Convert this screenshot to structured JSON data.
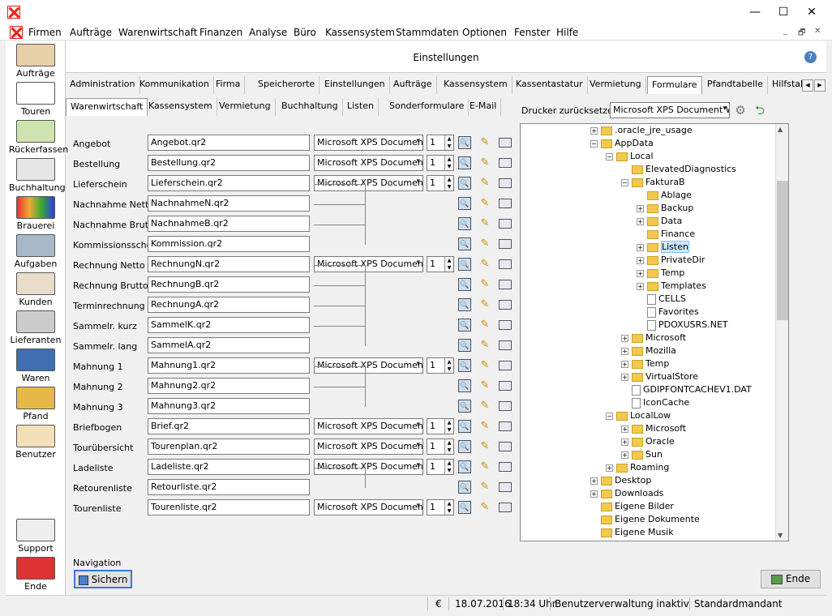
{
  "titlebar": {
    "close_glyph": "✕",
    "minimize": "—",
    "maximize": "☐",
    "close": "✕"
  },
  "menu": {
    "items": [
      "Firmen",
      "Aufträge",
      "Warenwirtschaft",
      "Finanzen",
      "Analyse",
      "Büro",
      "Kassensystem",
      "Stammdaten",
      "Optionen",
      "Fenster",
      "Hilfe"
    ],
    "mdi_min": "_",
    "mdi_restore": "🗗",
    "mdi_close": "✕"
  },
  "sidebar": {
    "items": [
      "Aufträge",
      "Touren",
      "Rückerfassen",
      "Buchhaltung",
      "Brauerei",
      "Aufgaben",
      "Kunden",
      "Lieferanten",
      "Waren",
      "Pfand",
      "Benutzer"
    ],
    "support": "Support",
    "ende": "Ende"
  },
  "header": {
    "title": "Einstellungen",
    "help_icon": "?"
  },
  "tabs_main": [
    "Administration",
    "Kommunikation",
    "Firma",
    "Speicherorte",
    "Einstellungen",
    "Aufträge",
    "Kassensystem",
    "Kassentastatur",
    "Vermietung",
    "Formulare",
    "Pfandtabelle",
    "Hilfstab"
  ],
  "tabs_sub": [
    "Warenwirtschaft",
    "Kassensystem",
    "Vermietung",
    "Buchhaltung",
    "Listen",
    "Sonderformulare",
    "E-Mail"
  ],
  "printer_reset": {
    "label": "Drucker zurücksetzen:",
    "value": "Microsoft XPS Document W"
  },
  "forms": [
    {
      "label": "Angebot",
      "file": "Angebot.qr2",
      "printer": "Microsoft XPS Documen",
      "copies": "1"
    },
    {
      "label": "Bestellung",
      "file": "Bestellung.qr2",
      "printer": "Microsoft XPS Documen",
      "copies": "1"
    },
    {
      "label": "Lieferschein",
      "file": "Lieferschein.qr2",
      "printer": "Microsoft XPS Documen",
      "copies": "1"
    },
    {
      "label": "Nachnahme Netto",
      "file": "NachnahmeN.qr2"
    },
    {
      "label": "Nachnahme Brutto",
      "file": "NachnahmeB.qr2"
    },
    {
      "label": "Kommissionsschein",
      "file": "Kommission.qr2"
    },
    {
      "label": "Rechnung Netto",
      "file": "RechnungN.qr2",
      "printer": "Microsoft XPS Documen",
      "copies": "1"
    },
    {
      "label": "Rechnung Brutto",
      "file": "RechnungB.qr2"
    },
    {
      "label": "Terminrechnung",
      "file": "RechnungA.qr2"
    },
    {
      "label": "Sammelr. kurz",
      "file": "SammelK.qr2"
    },
    {
      "label": "Sammelr. lang",
      "file": "SammelA.qr2"
    },
    {
      "label": "Mahnung 1",
      "file": "Mahnung1.qr2",
      "printer": "Microsoft XPS Documen",
      "copies": "1"
    },
    {
      "label": "Mahnung 2",
      "file": "Mahnung2.qr2"
    },
    {
      "label": "Mahnung 3",
      "file": "Mahnung3.qr2"
    },
    {
      "label": "Briefbogen",
      "file": "Brief.qr2",
      "printer": "Microsoft XPS Documen",
      "copies": "1"
    },
    {
      "label": "Tourübersicht",
      "file": "Tourenplan.qr2",
      "printer": "Microsoft XPS Documen",
      "copies": "1"
    },
    {
      "label": "Ladeliste",
      "file": "Ladeliste.qr2",
      "printer": "Microsoft XPS Documen",
      "copies": "1"
    },
    {
      "label": "Retourenliste",
      "file": "Retourliste.qr2"
    },
    {
      "label": "Tourenliste",
      "file": "Tourenliste.qr2",
      "printer": "Microsoft XPS Documen",
      "copies": "1"
    }
  ],
  "tree": [
    {
      "text": ".oracle_jre_usage",
      "depth": 1,
      "exp": "+",
      "type": "folder"
    },
    {
      "text": "AppData",
      "depth": 1,
      "exp": "-",
      "type": "folder"
    },
    {
      "text": "Local",
      "depth": 2,
      "exp": "-",
      "type": "folder"
    },
    {
      "text": "ElevatedDiagnostics",
      "depth": 3,
      "exp": "",
      "type": "folder"
    },
    {
      "text": "FakturaB",
      "depth": 3,
      "exp": "-",
      "type": "folder"
    },
    {
      "text": "Ablage",
      "depth": 4,
      "exp": "",
      "type": "folder"
    },
    {
      "text": "Backup",
      "depth": 4,
      "exp": "+",
      "type": "folder"
    },
    {
      "text": "Data",
      "depth": 4,
      "exp": "+",
      "type": "folder"
    },
    {
      "text": "Finance",
      "depth": 4,
      "exp": "",
      "type": "folder"
    },
    {
      "text": "Listen",
      "depth": 4,
      "exp": "+",
      "type": "folder",
      "selected": true
    },
    {
      "text": "PrivateDir",
      "depth": 4,
      "exp": "+",
      "type": "folder"
    },
    {
      "text": "Temp",
      "depth": 4,
      "exp": "+",
      "type": "folder"
    },
    {
      "text": "Templates",
      "depth": 4,
      "exp": "+",
      "type": "folder"
    },
    {
      "text": "CELLS",
      "depth": 4,
      "exp": "",
      "type": "file"
    },
    {
      "text": "Favorites",
      "depth": 4,
      "exp": "",
      "type": "file"
    },
    {
      "text": "PDOXUSRS.NET",
      "depth": 4,
      "exp": "",
      "type": "file"
    },
    {
      "text": "Microsoft",
      "depth": 3,
      "exp": "+",
      "type": "folder"
    },
    {
      "text": "Mozilla",
      "depth": 3,
      "exp": "+",
      "type": "folder"
    },
    {
      "text": "Temp",
      "depth": 3,
      "exp": "+",
      "type": "folder"
    },
    {
      "text": "VirtualStore",
      "depth": 3,
      "exp": "+",
      "type": "folder"
    },
    {
      "text": "GDIPFONTCACHEV1.DAT",
      "depth": 3,
      "exp": "",
      "type": "file"
    },
    {
      "text": "IconCache",
      "depth": 3,
      "exp": "",
      "type": "file"
    },
    {
      "text": "LocalLow",
      "depth": 2,
      "exp": "-",
      "type": "folder"
    },
    {
      "text": "Microsoft",
      "depth": 3,
      "exp": "+",
      "type": "folder"
    },
    {
      "text": "Oracle",
      "depth": 3,
      "exp": "+",
      "type": "folder"
    },
    {
      "text": "Sun",
      "depth": 3,
      "exp": "+",
      "type": "folder"
    },
    {
      "text": "Roaming",
      "depth": 2,
      "exp": "+",
      "type": "folder"
    },
    {
      "text": "Desktop",
      "depth": 1,
      "exp": "+",
      "type": "folder"
    },
    {
      "text": "Downloads",
      "depth": 1,
      "exp": "+",
      "type": "folder"
    },
    {
      "text": "Eigene Bilder",
      "depth": 1,
      "exp": "",
      "type": "folder"
    },
    {
      "text": "Eigene Dokumente",
      "depth": 1,
      "exp": "",
      "type": "folder"
    },
    {
      "text": "Eigene Musik",
      "depth": 1,
      "exp": "",
      "type": "folder"
    }
  ],
  "navigation": {
    "label": "Navigation",
    "save": "Sichern",
    "end": "Ende"
  },
  "status": {
    "currency": "€",
    "date": "18.07.2016",
    "time": "18:34 Uhr",
    "user_admin": "Benutzerverwaltung inaktiv",
    "client": "Standardmandant"
  }
}
